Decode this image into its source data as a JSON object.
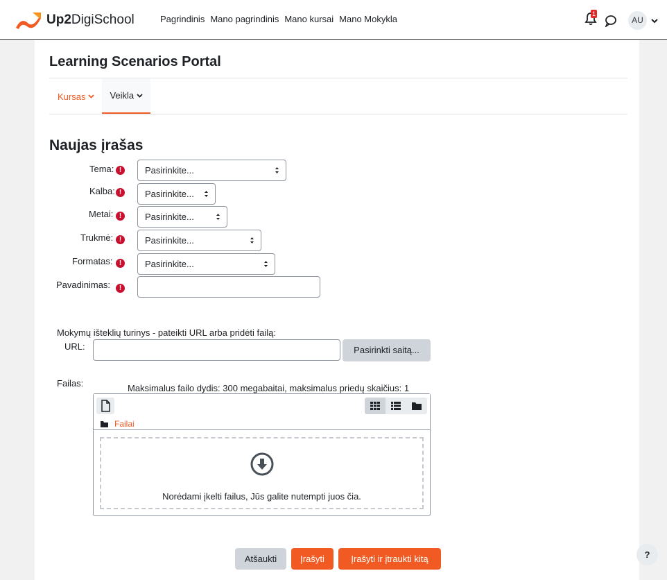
{
  "brand": {
    "name_bold": "Up2",
    "name_rest": "DigiSchool",
    "accent": "#f15a22"
  },
  "nav": {
    "items": [
      "Pagrindinis",
      "Mano pagrindinis",
      "Mano kursai",
      "Mano Mokykla"
    ]
  },
  "header_right": {
    "notification_count": "1",
    "user_initials": "AU"
  },
  "page": {
    "title": "Learning Scenarios Portal"
  },
  "subnav": {
    "kursas": "Kursas",
    "veikla": "Veikla"
  },
  "form": {
    "heading": "Naujas įrašas",
    "fields": {
      "tema": {
        "label": "Tema:",
        "value": "Pasirinkite..."
      },
      "kalba": {
        "label": "Kalba:",
        "value": "Pasirinkite..."
      },
      "metai": {
        "label": "Metai:",
        "value": "Pasirinkite..."
      },
      "trukme": {
        "label": "Trukmė:",
        "value": "Pasirinkite..."
      },
      "formatas": {
        "label": "Formatas:",
        "value": "Pasirinkite..."
      },
      "pavadinimas": {
        "label": "Pavadinimas:",
        "value": ""
      }
    },
    "resources_intro": "Mokymų išteklių turinys - pateikti URL arba pridėti failą:",
    "url_label": "URL:",
    "url_value": "",
    "choose_link": "Pasirinkti saitą...",
    "file_label": "Failas:",
    "file_limits": "Maksimalus failo dydis: 300 megabaitai, maksimalus priedų skaičius: 1",
    "files_folder": "Failai",
    "drop_text": "Norėdami įkelti failus, Jūs galite nutempti juos čia."
  },
  "buttons": {
    "cancel": "Atšaukti",
    "save": "Įrašyti",
    "save_add": "Įrašyti ir įtraukti kitą"
  },
  "help": {
    "label": "?"
  }
}
